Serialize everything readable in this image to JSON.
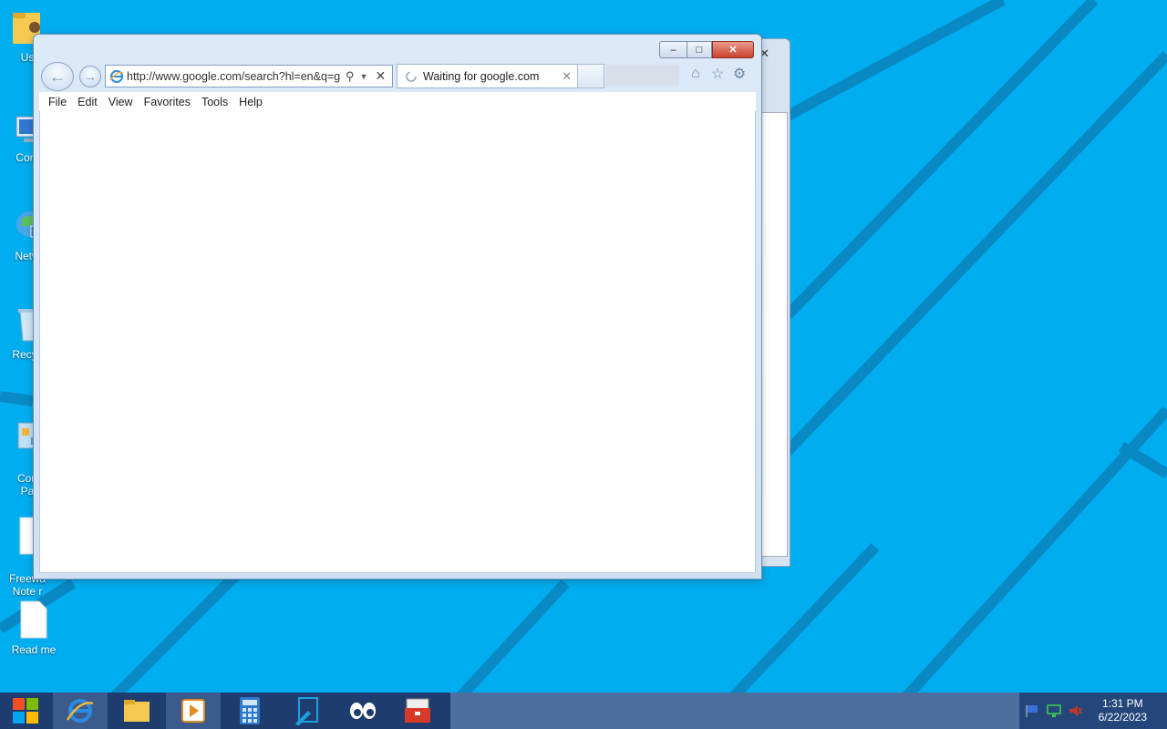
{
  "desktop": {
    "icons": [
      {
        "label": "Us",
        "icon": "user-folder-icon"
      },
      {
        "label": "Com",
        "icon": "computer-icon"
      },
      {
        "label": "Netw",
        "icon": "network-icon"
      },
      {
        "label": "Recyc",
        "icon": "recycle-bin-icon"
      },
      {
        "label": "Con\nPa",
        "icon": "control-panel-icon"
      },
      {
        "label": "Freewa\nNote r",
        "icon": "document-icon"
      },
      {
        "label": "Read me",
        "icon": "document-icon"
      }
    ]
  },
  "browser": {
    "address_url": "http://www.google.com/search?hl=en&q=g",
    "tab_title": "Waiting for google.com",
    "menu": [
      "File",
      "Edit",
      "View",
      "Favorites",
      "Tools",
      "Help"
    ],
    "caption": {
      "minimize": "–",
      "maximize": "□",
      "close": "✕"
    }
  },
  "taskbar": {
    "items": [
      "start-icon",
      "internet-explorer-icon",
      "file-explorer-icon",
      "media-player-icon",
      "calculator-icon",
      "paint-icon",
      "viewer-icon",
      "toolbox-icon"
    ],
    "clock_time": "1:31 PM",
    "clock_date": "6/22/2023"
  },
  "colors": {
    "desktop": "#00adef",
    "taskbar": "#1e3c6e",
    "window_frame": "#dce9f7"
  }
}
